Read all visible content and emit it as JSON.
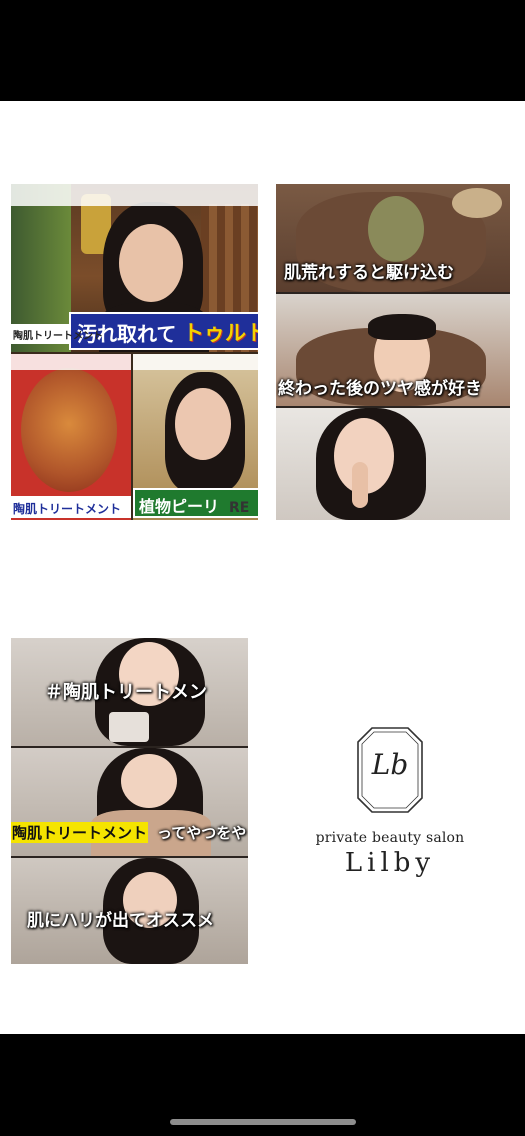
{
  "card1": {
    "banner_top": "汚れ取れて",
    "banner_top_accent": "トゥルト",
    "label_left_top": "陶肌トリートメント",
    "label_left_bottom": "陶肌トリートメント",
    "label_right_bottom": "植物ピーリ",
    "watermark": "RE"
  },
  "card2": {
    "caption_1": "肌荒れすると駆け込む",
    "caption_2": "終わった後のツヤ感が好き"
  },
  "card3": {
    "caption_1": "＃陶肌トリートメン",
    "caption_2_highlight": "陶肌トリートメント",
    "caption_2_rest": "ってやつをや",
    "caption_3": "肌にハリが出てオススメ"
  },
  "logo": {
    "monogram": "Lb",
    "tagline": "private beauty salon",
    "name": "Lilby"
  },
  "colors": {
    "banner_blue": "#1f2f9a",
    "banner_yellow": "#f4d400",
    "label_green": "#1f7a2e",
    "highlight_yellow": "#f5e400"
  }
}
